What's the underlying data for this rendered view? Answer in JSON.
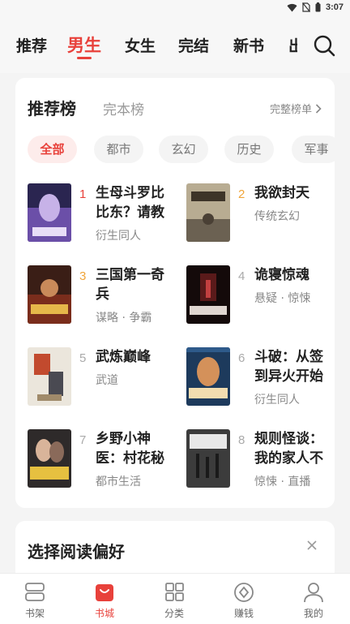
{
  "status_bar": {
    "time": "3:07"
  },
  "top_tabs": [
    "推荐",
    "男生",
    "女生",
    "完结",
    "新书",
    "出"
  ],
  "ranking": {
    "tabs": [
      "推荐榜",
      "完本榜"
    ],
    "full_list_label": "完整榜单",
    "chips": [
      "全部",
      "都市",
      "玄幻",
      "历史",
      "军事"
    ],
    "books": [
      {
        "rank": "1",
        "title": "生母斗罗比比东？请教",
        "tag": "衍生同人"
      },
      {
        "rank": "2",
        "title": "我欲封天",
        "tag": "传统玄幻"
      },
      {
        "rank": "3",
        "title": "三国第一奇兵",
        "tag": "谋略 · 争霸"
      },
      {
        "rank": "4",
        "title": "诡寝惊魂",
        "tag": "悬疑 · 惊悚"
      },
      {
        "rank": "5",
        "title": "武炼巅峰",
        "tag": "武道"
      },
      {
        "rank": "6",
        "title": "斗破：从签到异火开始",
        "tag": "衍生同人"
      },
      {
        "rank": "7",
        "title": "乡野小神医：村花秘",
        "tag": "都市生活"
      },
      {
        "rank": "8",
        "title": "规则怪谈：我的家人不",
        "tag": "惊悚 · 直播"
      }
    ]
  },
  "preference": {
    "title": "选择阅读偏好"
  },
  "bottom_nav": [
    "书架",
    "书城",
    "分类",
    "赚钱",
    "我的"
  ],
  "colors": {
    "accent": "#e8413b",
    "gold": "#f0a53a"
  }
}
